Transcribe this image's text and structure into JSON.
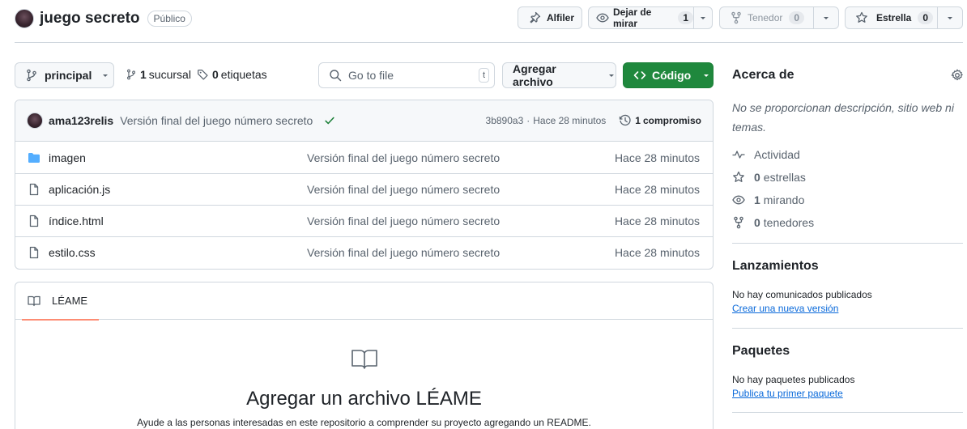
{
  "header": {
    "repo_name": "juego secreto",
    "visibility": "Público",
    "pin_label": "Alfiler",
    "watch_label": "Dejar de mirar",
    "watch_count": "1",
    "fork_label": "Tenedor",
    "fork_count": "0",
    "star_label": "Estrella",
    "star_count": "0"
  },
  "toolbar": {
    "branch": "principal",
    "branches_count": "1",
    "branches_label": "sucursal",
    "tags_count": "0",
    "tags_label": "etiquetas",
    "search_placeholder": "Go to file",
    "search_shortcut": "t",
    "add_file_label": "Agregar archivo",
    "code_label": "Código"
  },
  "commit": {
    "author": "ama123relis",
    "message": "Versión final del juego número secreto",
    "hash": "3b890a3",
    "separator": "·",
    "time": "Hace 28 minutos",
    "commits_count": "1",
    "commits_label": "compromiso"
  },
  "files": [
    {
      "name": "imagen",
      "type": "folder",
      "message": "Versión final del juego número secreto",
      "time": "Hace 28 minutos"
    },
    {
      "name": "aplicación.js",
      "type": "file",
      "message": "Versión final del juego número secreto",
      "time": "Hace 28 minutos"
    },
    {
      "name": "índice.html",
      "type": "file",
      "message": "Versión final del juego número secreto",
      "time": "Hace 28 minutos"
    },
    {
      "name": "estilo.css",
      "type": "file",
      "message": "Versión final del juego número secreto",
      "time": "Hace 28 minutos"
    }
  ],
  "readme": {
    "tab_label": "LÉAME",
    "title": "Agregar un archivo LÉAME",
    "subtitle": "Ayude a las personas interesadas en este repositorio a comprender su proyecto agregando un README."
  },
  "sidebar": {
    "about_title": "Acerca de",
    "about_text": "No se proporcionan descripción, sitio web ni temas.",
    "activity_label": "Actividad",
    "stars_count": "0",
    "stars_label": "estrellas",
    "watching_count": "1",
    "watching_label": "mirando",
    "forks_count": "0",
    "forks_label": "tenedores",
    "releases_title": "Lanzamientos",
    "releases_text": "No hay comunicados publicados",
    "releases_link": "Crear una nueva versión",
    "packages_title": "Paquetes",
    "packages_text": "No hay paquetes publicados",
    "packages_link": "Publica tu primer paquete"
  },
  "colors": {
    "accent_green": "#1f883d",
    "link_blue": "#0969da",
    "folder_blue": "#54aeff",
    "tab_underline": "#fd8c73",
    "check_green": "#1a7f37"
  }
}
